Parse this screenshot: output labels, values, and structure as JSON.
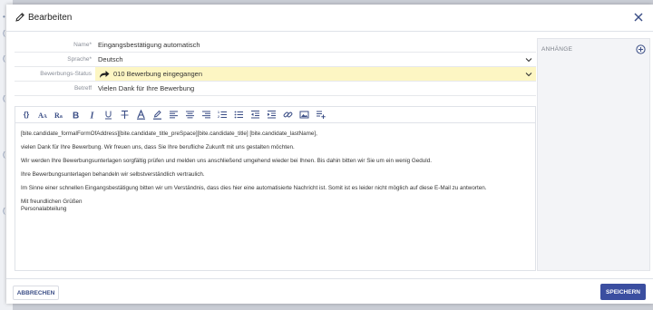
{
  "background": {
    "marks": [
      "•",
      "(",
      "(",
      "(",
      "(",
      "("
    ]
  },
  "header": {
    "title": "Bearbeiten"
  },
  "form": {
    "name_label": "Name*",
    "name_value": "Eingangsbestätigung automatisch",
    "language_label": "Sprache*",
    "language_value": "Deutsch",
    "status_label": "Bewerbungs-Status",
    "status_value": "010 Bewerbung eingegangen",
    "subject_label": "Betreff",
    "subject_value": "Vielen Dank für Ihre Bewerbung"
  },
  "toolbar": {
    "items": [
      "braces-icon",
      "font-size-icon",
      "font-family-icon",
      "bold-icon",
      "italic-icon",
      "underline-icon",
      "strikethrough-icon",
      "text-color-icon",
      "highlight-icon",
      "align-left-icon",
      "align-center-icon",
      "align-right-icon",
      "ordered-list-icon",
      "unordered-list-icon",
      "outdent-icon",
      "indent-icon",
      "link-icon",
      "image-icon",
      "insert-icon"
    ]
  },
  "editor": {
    "line1": "[bite.candidate_formalFormOfAddress][bite.candidate_title_preSpace][bite.candidate_title] [bite.candidate_lastName],",
    "line2": "vielen Dank für Ihre Bewerbung. Wir freuen uns, dass Sie Ihre berufliche Zukunft mit uns gestalten möchten.",
    "line3": "Wir werden Ihre Bewerbungsunterlagen sorgfältig prüfen und melden uns anschließend umgehend wieder bei Ihnen. Bis dahin bitten wir Sie um ein wenig Geduld.",
    "line4": "Ihre Bewerbungsunterlagen behandeln wir selbstverständlich vertraulich.",
    "line5": "Im Sinne einer schnellen Eingangsbestätigung bitten wir um Verständnis, dass dies hier eine automatisierte Nachricht ist. Somit ist es leider nicht möglich auf diese E-Mail zu antworten.",
    "line6": "Mit freundlichen Grüßen",
    "line7": "Personalabteilung"
  },
  "attachments": {
    "label": "ANHÄNGE"
  },
  "footer": {
    "cancel_label": "ABBRECHEN",
    "save_label": "SPEICHERN"
  },
  "colors": {
    "accent": "#3b4ea0",
    "status_highlight": "#fdf6c3"
  }
}
